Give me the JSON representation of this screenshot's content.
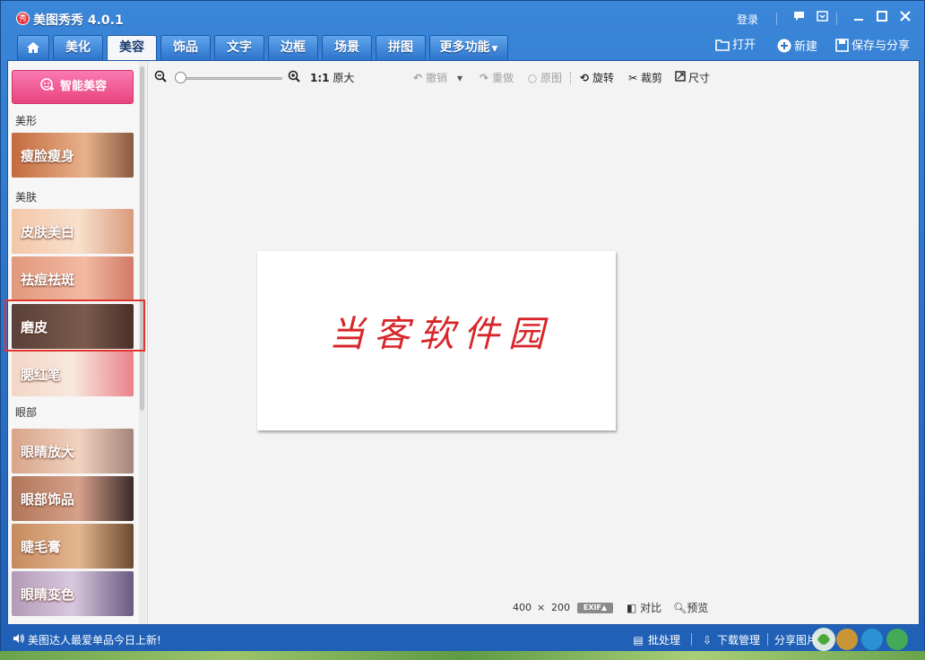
{
  "app": {
    "title": "美图秀秀 4.0.1",
    "logo_text": "秀",
    "login_label": "登录"
  },
  "tabs": [
    {
      "label": "",
      "icon": "home-icon"
    },
    {
      "label": "美化"
    },
    {
      "label": "美容"
    },
    {
      "label": "饰品"
    },
    {
      "label": "文字"
    },
    {
      "label": "边框"
    },
    {
      "label": "场景"
    },
    {
      "label": "拼图"
    },
    {
      "label": "更多功能"
    }
  ],
  "top_actions": {
    "open": "打开",
    "new": "新建",
    "save_share": "保存与分享"
  },
  "sidebar": {
    "smart_beauty": "智能美容",
    "sections": {
      "shape": "美形",
      "skin": "美肤",
      "eyes": "眼部"
    },
    "tools": {
      "slim": "瘦脸瘦身",
      "whiten": "皮肤美白",
      "acne": "祛痘祛斑",
      "smooth": "磨皮",
      "blush": "腮红笔",
      "eye_enlarge": "眼睛放大",
      "eye_accessory": "眼部饰品",
      "mascara": "睫毛膏",
      "eye_color": "眼睛变色"
    }
  },
  "toolbar": {
    "ratio_prefix": "1:1",
    "original_size": "原大",
    "undo": "撤销",
    "redo": "重做",
    "original": "原图",
    "rotate": "旋转",
    "crop": "裁剪",
    "resize": "尺寸",
    "zoom_level": 0
  },
  "canvas": {
    "text": "当客软件园"
  },
  "image_info": {
    "width": "400",
    "times": "×",
    "height": "200",
    "exif": "EXIF▲",
    "compare": "对比",
    "preview": "预览"
  },
  "status": {
    "news": "美图达人最爱单品今日上新!",
    "batch": "批处理",
    "download": "下载管理",
    "share": "分享图片"
  },
  "colors": {
    "accent": "#2d74cc",
    "smart_button": "#e8437e",
    "selection": "#e0342c",
    "canvas_text": "#d8262a"
  }
}
